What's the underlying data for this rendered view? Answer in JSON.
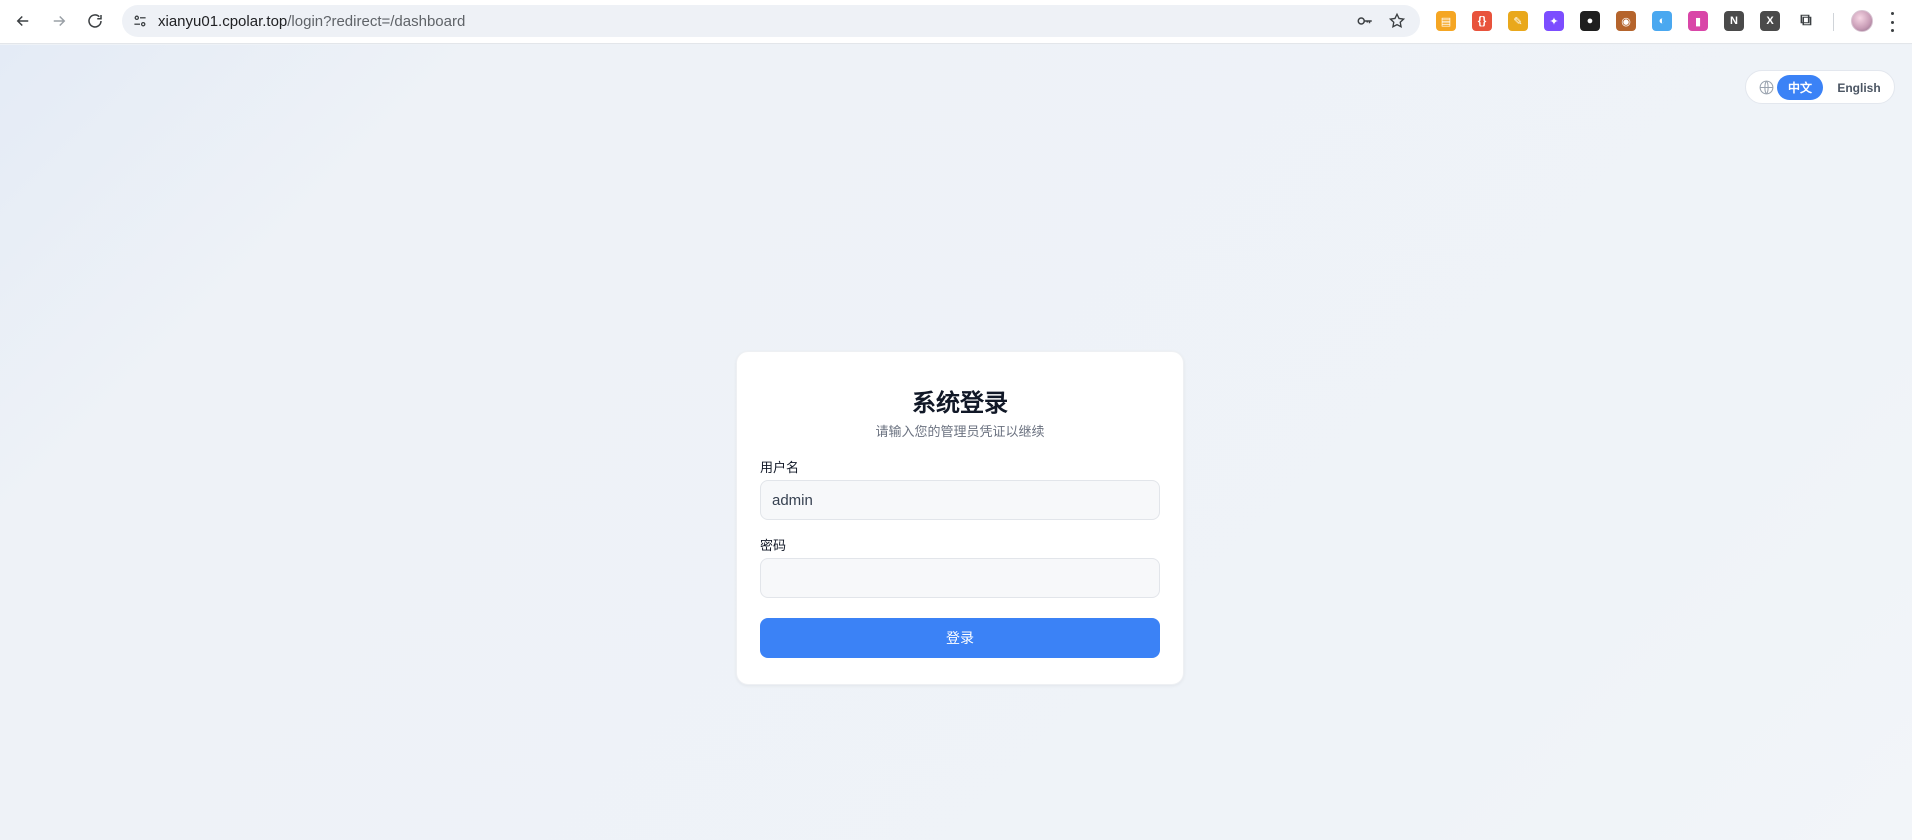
{
  "browser": {
    "url_host": "xianyu01.cpolar.top",
    "url_path": "/login?redirect=/dashboard",
    "extensions": [
      {
        "name": "ext-notes-icon",
        "glyph": "▤",
        "color": "#f5a623"
      },
      {
        "name": "ext-braces-icon",
        "glyph": "{}",
        "color": "#e8533c"
      },
      {
        "name": "ext-tool-icon",
        "glyph": "✎",
        "color": "#e9a81c"
      },
      {
        "name": "ext-sparkle-icon",
        "glyph": "✦",
        "color": "#7c4dff"
      },
      {
        "name": "ext-panda-icon",
        "glyph": "●",
        "color": "#1f1f1f"
      },
      {
        "name": "ext-cat-icon",
        "glyph": "◉",
        "color": "#b5642c"
      },
      {
        "name": "ext-color-wheel-icon",
        "glyph": "◐",
        "color": "#4aa8f0"
      },
      {
        "name": "ext-gift-icon",
        "glyph": "▮",
        "color": "#d946a8"
      },
      {
        "name": "ext-notion-icon",
        "glyph": "N",
        "color": "#4a4a4a"
      },
      {
        "name": "ext-x-icon",
        "glyph": "X",
        "color": "#4a4a4a"
      },
      {
        "name": "extensions-puzzle-icon",
        "glyph": "⧉",
        "color": "#ffffff"
      }
    ]
  },
  "lang": {
    "zh": "中文",
    "en": "English"
  },
  "login": {
    "title": "系统登录",
    "subtitle": "请输入您的管理员凭证以继续",
    "username_label": "用户名",
    "username_value": "admin",
    "password_label": "密码",
    "password_value": "",
    "submit_label": "登录"
  },
  "colors": {
    "accent": "#3b82f6",
    "page_bg": "#eef2f7"
  }
}
